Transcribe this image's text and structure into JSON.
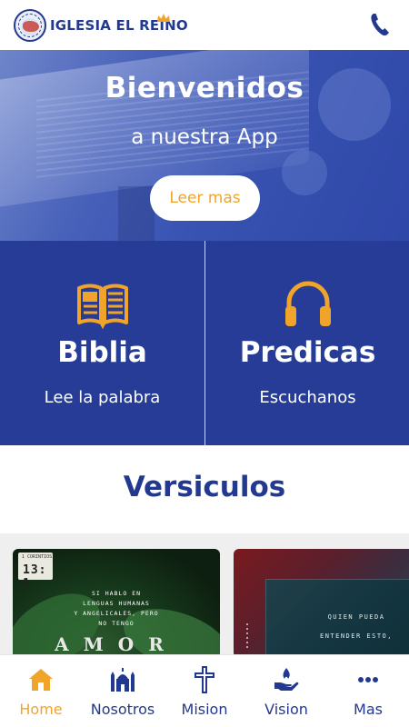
{
  "colors": {
    "brand_blue": "#263c97",
    "accent_orange": "#f0a52a",
    "white": "#ffffff"
  },
  "header": {
    "brand": "IGLESIA EL REINO",
    "logo_icon": "church-logo-icon",
    "crown_icon": "crown-icon",
    "phone_icon": "phone-icon"
  },
  "hero": {
    "title": "Bienvenidos",
    "subtitle": "a nuestra App",
    "button_label": "Leer mas"
  },
  "tiles": [
    {
      "icon": "open-book-icon",
      "title": "Biblia",
      "subtitle": "Lee la palabra"
    },
    {
      "icon": "headphones-icon",
      "title": "Predicas",
      "subtitle": "Escuchanos"
    }
  ],
  "versiculos": {
    "title": "Versiculos",
    "cards": [
      {
        "ref_book": "1 CORINTIOS",
        "ref_chapter": "13: 1",
        "verse": "SI HABLO EN\nLENGUAS HUMANAS\nY ANGELICALES, PERO\nNO TENGO",
        "keyword": "AMOR"
      },
      {
        "verse": "QUIEN PUEDA\nENTENDER ESTO,"
      }
    ]
  },
  "nav": [
    {
      "label": "Home",
      "icon": "home-icon",
      "active": true
    },
    {
      "label": "Nosotros",
      "icon": "mosque-icon",
      "active": false
    },
    {
      "label": "Mision",
      "icon": "cross-icon",
      "active": false
    },
    {
      "label": "Vision",
      "icon": "hand-flame-icon",
      "active": false
    },
    {
      "label": "Mas",
      "icon": "more-dots-icon",
      "active": false
    }
  ]
}
